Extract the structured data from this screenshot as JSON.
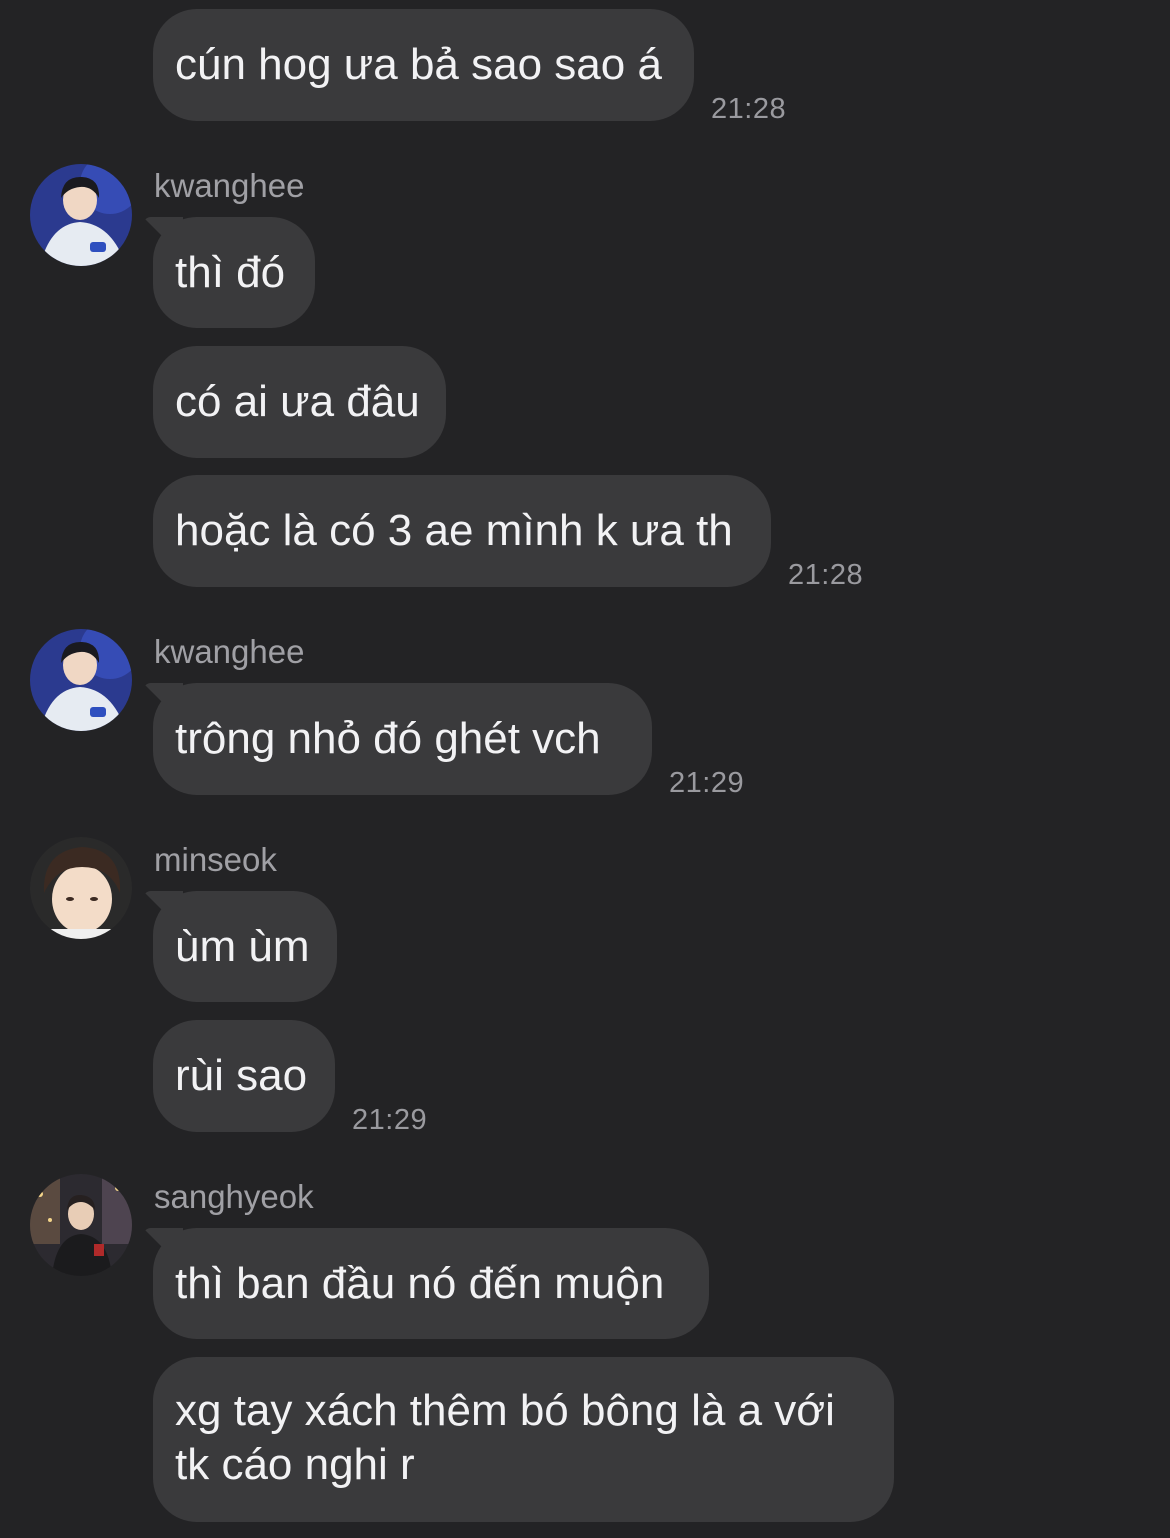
{
  "colors": {
    "background": "#232325",
    "bubble": "#3a3a3c",
    "text": "#f2f2f4",
    "meta_text": "#9a9a9f"
  },
  "messages": [
    {
      "text": "cún hog ưa bả sao sao á",
      "time": "21:28"
    },
    {
      "sender": "kwanghee",
      "avatar_icon": "kwanghee-avatar",
      "text": "thì đó"
    },
    {
      "text": "có ai ưa đâu"
    },
    {
      "text": "hoặc là có 3 ae mình k ưa th",
      "time": "21:28"
    },
    {
      "sender": "kwanghee",
      "avatar_icon": "kwanghee-avatar",
      "text": "trông nhỏ đó ghét vch",
      "time": "21:29"
    },
    {
      "sender": "minseok",
      "avatar_icon": "minseok-avatar",
      "text": "ùm ùm"
    },
    {
      "text": "rùi sao",
      "time": "21:29"
    },
    {
      "sender": "sanghyeok",
      "avatar_icon": "sanghyeok-avatar",
      "text": "thì ban đầu nó đến muộn"
    },
    {
      "text": "xg tay xách thêm bó bông là a với tk cáo nghi r"
    }
  ]
}
